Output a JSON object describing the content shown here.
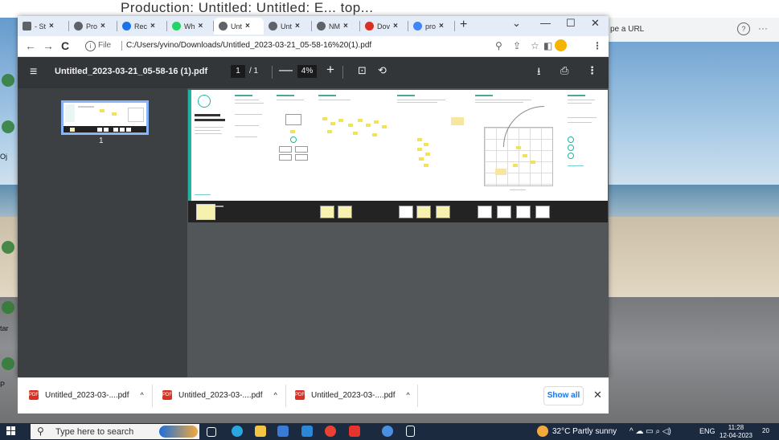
{
  "desktop": {
    "banner_text": "Production: Untitled: Untitled: E... top...",
    "icon_labels": [
      "Oj",
      "tar",
      "P"
    ]
  },
  "background_window": {
    "url_hint": "pe a URL",
    "help_glyph": "?",
    "menu_glyph": "···"
  },
  "browser": {
    "tabs": [
      {
        "label": "- St",
        "color": "#5f6368"
      },
      {
        "label": "Pro",
        "color": "#5f6368"
      },
      {
        "label": "Rec",
        "color": "#1a73e8"
      },
      {
        "label": "Wh",
        "color": "#25d366"
      },
      {
        "label": "Unt",
        "color": "#5f6368",
        "active": true
      },
      {
        "label": "Unt",
        "color": "#5f6368"
      },
      {
        "label": "NM",
        "color": "#5f6368"
      },
      {
        "label": "Dov",
        "color": "#d93025"
      },
      {
        "label": "pro",
        "color": "#4285f4"
      }
    ],
    "tab_close": "×",
    "new_tab": "+",
    "controls": {
      "dropdown": "⌄",
      "minimize": "—",
      "maximize": "☐",
      "close": "✕"
    },
    "nav": {
      "back": "←",
      "forward": "→",
      "reload": "C"
    },
    "address": {
      "scheme_label": "File",
      "url": "C:/Users/yvino/Downloads/Untitled_2023-03-21_05-58-16%20(1).pdf"
    },
    "toolbar_icons": {
      "zoom": "⚲",
      "share": "⇪",
      "bookmark": "☆",
      "side_panel": "◧",
      "menu": "⋮"
    }
  },
  "pdf_viewer": {
    "menu_glyph": "≡",
    "title": "Untitled_2023-03-21_05-58-16 (1).pdf",
    "current_page": "1",
    "page_total": "/ 1",
    "zoom_out": "—",
    "zoom": "4%",
    "zoom_in": "+",
    "fit_glyph": "⊡",
    "rotate_glyph": "⟲",
    "download_glyph": "⭳",
    "print_glyph": "⎙",
    "more_glyph": "⋮",
    "thumbnail_label": "1"
  },
  "downloads": {
    "items": [
      {
        "name": "Untitled_2023-03-....pdf"
      },
      {
        "name": "Untitled_2023-03-....pdf"
      },
      {
        "name": "Untitled_2023-03-....pdf"
      }
    ],
    "file_badge": "PDF",
    "chevron": "^",
    "show_all": "Show all",
    "close": "✕"
  },
  "taskbar": {
    "search_placeholder": "Type here to search",
    "weather": "32°C  Partly sunny",
    "tray_icons": "^ ☁ ▭ ⌕ ◁)",
    "language": "ENG",
    "time": "11:28",
    "date": "12-04-2023",
    "notification_count": "20"
  },
  "colors": {
    "accent": "#1a73e8",
    "pdf_toolbar": "#323639",
    "pdf_sidebar": "#3c4043",
    "pdf_canvas": "#525659",
    "sticky_note": "#f0e35a",
    "taskbar": "#1c2a3f"
  }
}
